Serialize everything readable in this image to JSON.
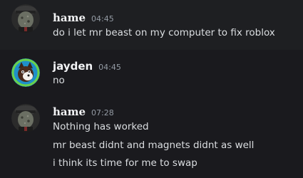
{
  "messages": [
    {
      "username": "hame",
      "time": "04:45",
      "lines": [
        "do i let mr beast on my computer to fix roblox"
      ]
    },
    {
      "username": "jayden",
      "time": "04:45",
      "lines": [
        "no"
      ]
    },
    {
      "username": "hame",
      "time": "07:28",
      "lines": [
        "Nothing has worked",
        "mr beast didnt and magnets didnt as well",
        "i think its time for me to swap"
      ]
    }
  ],
  "colors": {
    "background": "#1a1a1e",
    "hover": "#1e1f22",
    "username": "#f2f3f5",
    "text": "#dbdee1",
    "timestamp": "#949ba4"
  }
}
